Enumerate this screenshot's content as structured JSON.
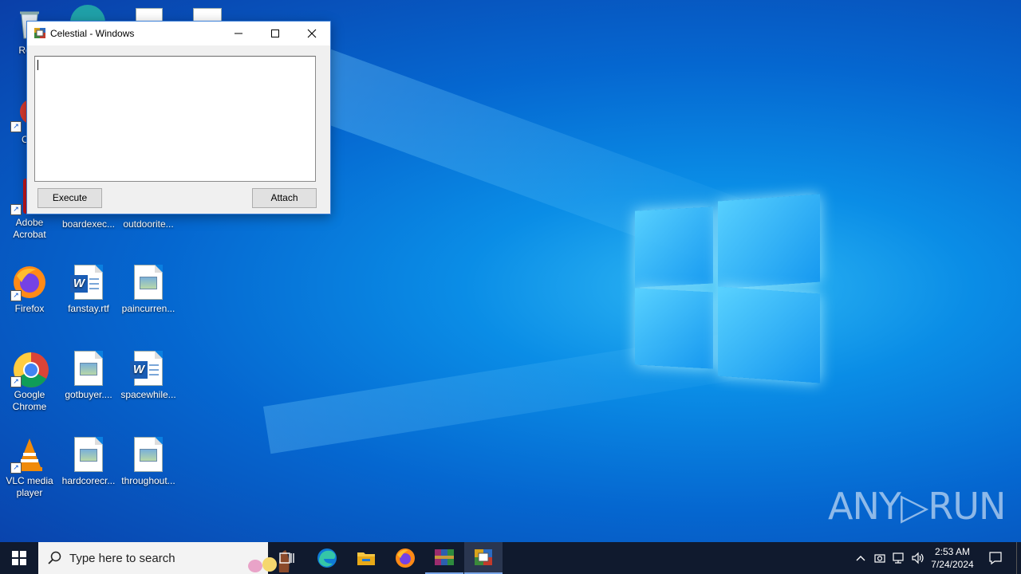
{
  "desktop": {
    "icons": [
      {
        "label": "Recy",
        "icon": "recycle-bin-icon"
      },
      {
        "label": "CCl",
        "icon": "ccleaner-icon"
      },
      {
        "label": "Adobe Acrobat",
        "icon": "adobe-acrobat-icon"
      },
      {
        "label": "boardexec...",
        "icon": "image-file-icon"
      },
      {
        "label": "outdoorite...",
        "icon": "image-file-icon"
      },
      {
        "label": "Firefox",
        "icon": "firefox-icon"
      },
      {
        "label": "fanstay.rtf",
        "icon": "word-document-icon"
      },
      {
        "label": "paincurren...",
        "icon": "image-file-icon"
      },
      {
        "label": "Google Chrome",
        "icon": "chrome-icon"
      },
      {
        "label": "gotbuyer....",
        "icon": "image-file-icon"
      },
      {
        "label": "spacewhile...",
        "icon": "word-document-icon"
      },
      {
        "label": "VLC media player",
        "icon": "vlc-icon"
      },
      {
        "label": "hardcorecr...",
        "icon": "image-file-icon"
      },
      {
        "label": "throughout...",
        "icon": "image-file-icon"
      }
    ]
  },
  "window": {
    "title": "Celestial - Windows",
    "editor_value": "",
    "execute_label": "Execute",
    "attach_label": "Attach"
  },
  "watermark": {
    "text": "ANY▷RUN"
  },
  "taskbar": {
    "search_placeholder": "Type here to search",
    "time": "2:53 AM",
    "date": "7/24/2024",
    "pinned": [
      "task-view",
      "edge",
      "file-explorer",
      "firefox",
      "winrar",
      "celestial"
    ]
  },
  "colors": {
    "desktop_accent": "#0a8de6",
    "taskbar": "#101a2e",
    "window_border": "#3b7fd8"
  }
}
